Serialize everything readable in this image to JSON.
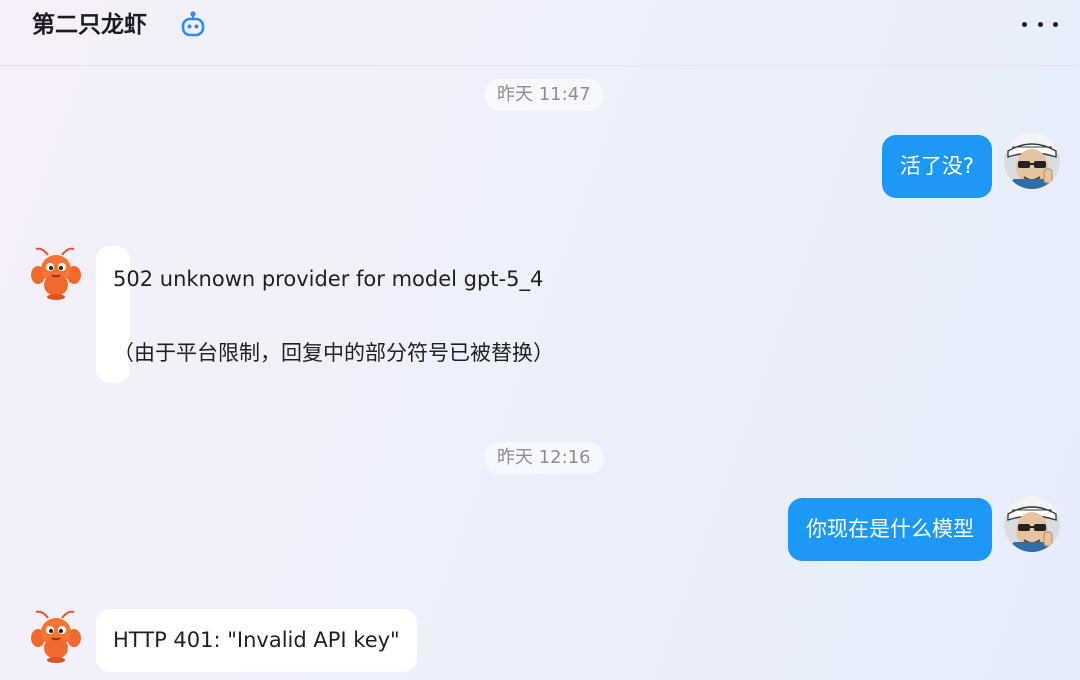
{
  "header": {
    "title": "第二只龙虾",
    "bot_icon": "robot-icon",
    "more_icon": "more-horizontal-icon"
  },
  "colors": {
    "user_bubble": "#1e98f5",
    "bot_bubble": "#ffffff",
    "timestamp_text": "#8c8d96"
  },
  "messages": [
    {
      "type": "timestamp",
      "text": "昨天 11:47"
    },
    {
      "type": "user",
      "text": "活了没?",
      "avatar": "user-avatar"
    },
    {
      "type": "bot",
      "lines": [
        "502 unknown provider for model gpt-5_4",
        "（由于平台限制，回复中的部分符号已被替换）"
      ],
      "avatar": "lobster-avatar"
    },
    {
      "type": "timestamp",
      "text": "昨天 12:16"
    },
    {
      "type": "user",
      "text": "你现在是什么模型",
      "avatar": "user-avatar"
    },
    {
      "type": "bot",
      "lines": [
        "HTTP 401: \"Invalid API key\""
      ],
      "avatar": "lobster-avatar"
    }
  ]
}
